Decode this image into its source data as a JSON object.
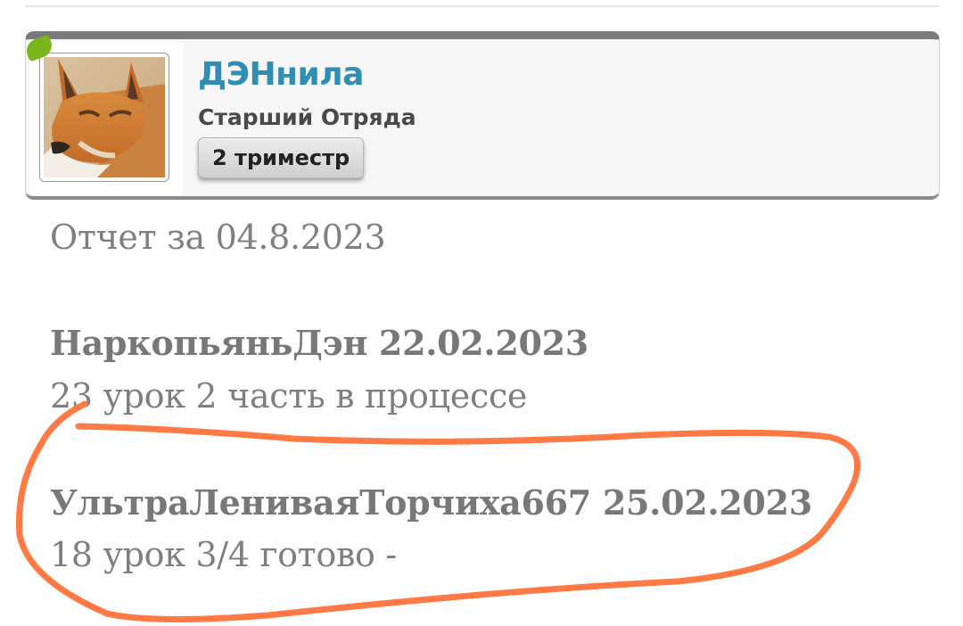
{
  "profile": {
    "username": "ДЭНнила",
    "rank": "Старший Отряда",
    "badge": "2 триместр",
    "avatar_icon": "fox-avatar",
    "online_indicator_color": "#7ab51d",
    "username_color": "#2f8fb3"
  },
  "post": {
    "report_line": "Отчет за 04.8.2023",
    "entries": [
      {
        "title": "НаркопьяньДэн 22.02.2023",
        "status": "23 урок 2 часть в процессе"
      },
      {
        "title": "УльтраЛениваяТорчиха667 25.02.2023",
        "status": "18 урок 3/4 готово -"
      }
    ]
  },
  "annotation": {
    "color": "#ff7a45"
  }
}
